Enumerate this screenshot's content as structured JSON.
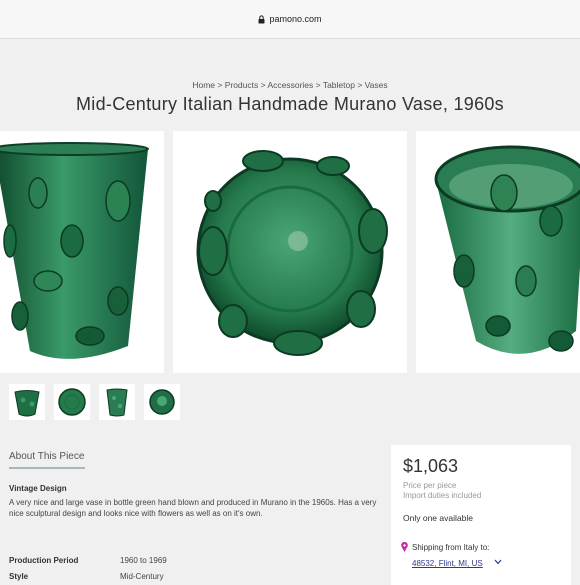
{
  "browser": {
    "domain": "pamono.com"
  },
  "breadcrumb": "Home > Products > Accessories > Tabletop > Vases",
  "product": {
    "title": "Mid-Century Italian Handmade Murano Vase, 1960s",
    "images": [
      "vase-side-view",
      "vase-top-view",
      "vase-angled-view"
    ],
    "thumbnails": [
      "thumb-1",
      "thumb-2",
      "thumb-3",
      "thumb-4"
    ]
  },
  "about": {
    "tab_label": "About This Piece",
    "section_title": "Vintage Design",
    "description": "A very nice and large vase in bottle green hand blown and produced in Murano in the 1960s. Has a very nice sculptural design and looks nice with flowers as well as on it's own.",
    "specs": [
      {
        "label": "Production Period",
        "value": "1960 to 1969"
      },
      {
        "label": "Style",
        "value": "Mid-Century"
      }
    ]
  },
  "purchase": {
    "price": "$1,063",
    "price_note": "Price per piece",
    "duties_note": "Import duties included",
    "availability": "Only one available",
    "shipping_label": "Shipping from Italy to:",
    "shipping_location": "48532, Flint, MI, US"
  },
  "colors": {
    "glass_green": "#1f6e44",
    "link_blue": "#2a3b8f",
    "pin_magenta": "#c0309a"
  },
  "icons": {
    "lock": "lock-icon",
    "pin": "location-pin-icon",
    "chevron": "chevron-down-icon"
  }
}
